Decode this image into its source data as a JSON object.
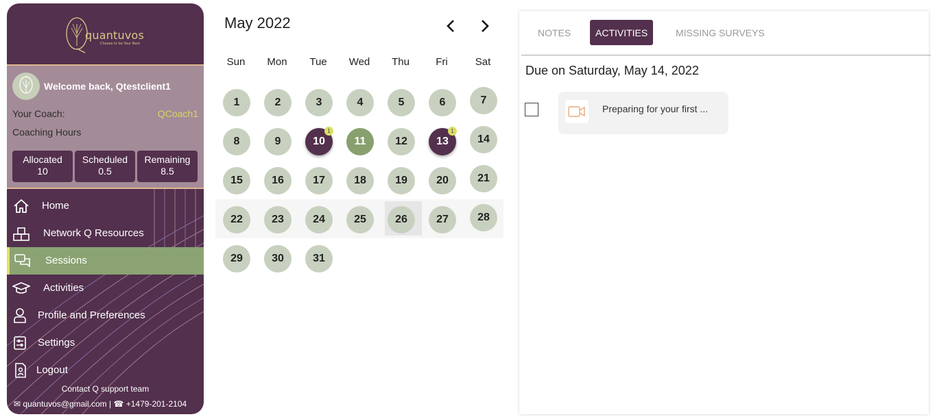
{
  "brand": {
    "name": "quantuvos",
    "tagline": "Choose to be Your Best"
  },
  "profile": {
    "welcome": "Welcome back, Qtestclient1",
    "coach_label": "Your Coach:",
    "coach_name": "QCoach1",
    "hours_label": "Coaching Hours",
    "hours": [
      {
        "label": "Allocated",
        "value": "10"
      },
      {
        "label": "Scheduled",
        "value": "0.5"
      },
      {
        "label": "Remaining",
        "value": "8.5"
      }
    ]
  },
  "nav": [
    {
      "label": "Home",
      "icon": "home-icon"
    },
    {
      "label": "Network Q Resources",
      "icon": "boxes-icon"
    },
    {
      "label": "Sessions",
      "icon": "chat-icon",
      "active": true
    },
    {
      "label": "Activities",
      "icon": "graduation-cap-icon"
    },
    {
      "label": "Profile and Preferences",
      "icon": "user-icon"
    },
    {
      "label": "Settings",
      "icon": "sliders-icon"
    },
    {
      "label": "Logout",
      "icon": "logout-icon"
    }
  ],
  "contact": {
    "title": "Contact Q support team",
    "email": "quantuvos@gmail.com",
    "phone": "+1479-201-2104"
  },
  "calendar": {
    "title": "May 2022",
    "weekdays": [
      "Sun",
      "Mon",
      "Tue",
      "Wed",
      "Thu",
      "Fri",
      "Sat"
    ],
    "weeks": [
      [
        "1",
        "2",
        "3",
        "4",
        "5",
        "6",
        "7"
      ],
      [
        "8",
        "9",
        "10",
        "11",
        "12",
        "13",
        "14"
      ],
      [
        "15",
        "16",
        "17",
        "18",
        "19",
        "20",
        "21"
      ],
      [
        "22",
        "23",
        "24",
        "25",
        "26",
        "27",
        "28"
      ],
      [
        "29",
        "30",
        "31"
      ]
    ],
    "purple_days": [
      "10",
      "13"
    ],
    "green_days": [
      "11"
    ],
    "today": "26",
    "badges": {
      "10": "1",
      "13": "1"
    }
  },
  "panel": {
    "tabs": [
      "NOTES",
      "ACTIVITIES",
      "MISSING SURVEYS"
    ],
    "active_tab": "ACTIVITIES",
    "due_title": "Due on Saturday, May 14, 2022",
    "activity": {
      "text": "Preparing for your first ...",
      "icon": "video-camera-icon"
    }
  },
  "colors": {
    "plum": "#53304d",
    "mauve": "#a38b98",
    "sage": "#c8d1bf",
    "green": "#87a06e",
    "yellow": "#d9e063"
  }
}
